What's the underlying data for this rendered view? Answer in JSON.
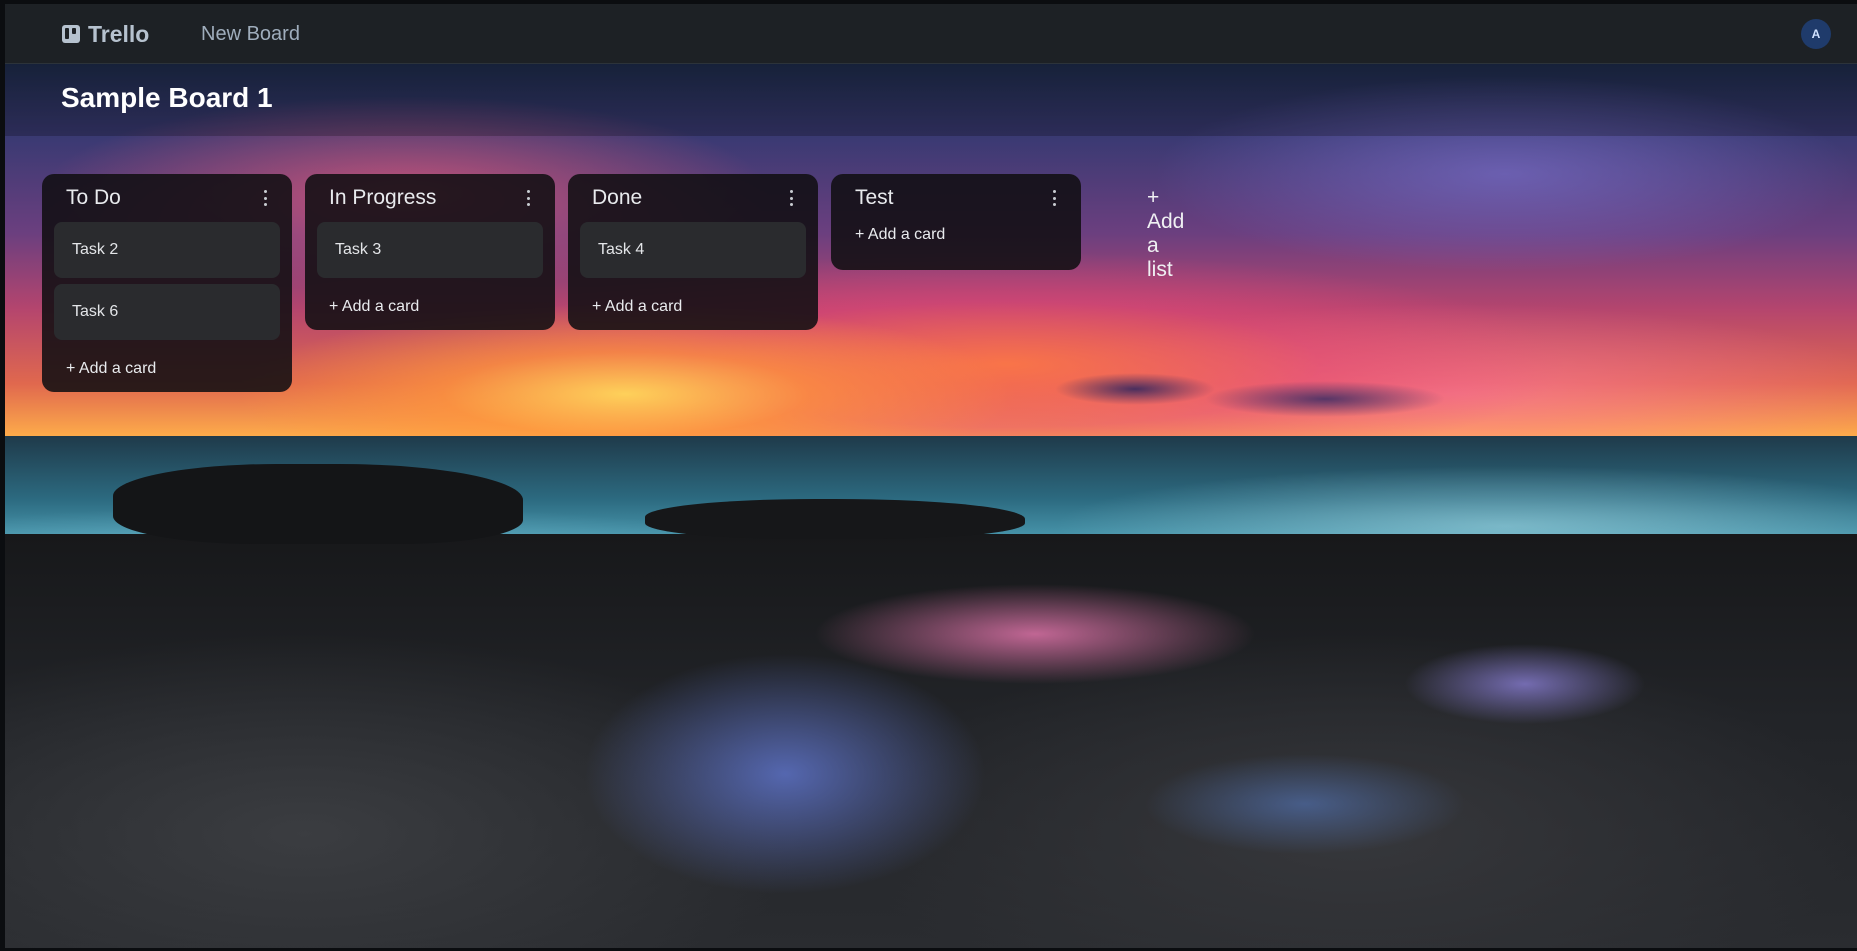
{
  "nav": {
    "brand": "Trello",
    "new_board": "New Board",
    "avatar_initial": "A"
  },
  "board": {
    "title": "Sample Board 1"
  },
  "lists": [
    {
      "title": "To Do",
      "cards": [
        "Task 2",
        "Task 6"
      ],
      "add_card": "+ Add a card"
    },
    {
      "title": "In Progress",
      "cards": [
        "Task 3"
      ],
      "add_card": "+ Add a card"
    },
    {
      "title": "Done",
      "cards": [
        "Task 4"
      ],
      "add_card": "+ Add a card"
    },
    {
      "title": "Test",
      "cards": [],
      "add_card": "+ Add a card"
    }
  ],
  "add_list": "+ Add a list",
  "icons": {
    "brand": "trello-board-icon",
    "list_menu": "vertical-dots-icon"
  },
  "colors": {
    "nav_bg": "#1d2125",
    "list_bg": "#110f12",
    "card_bg": "#2a2b2e",
    "avatar_bg": "#1f3b6b"
  }
}
